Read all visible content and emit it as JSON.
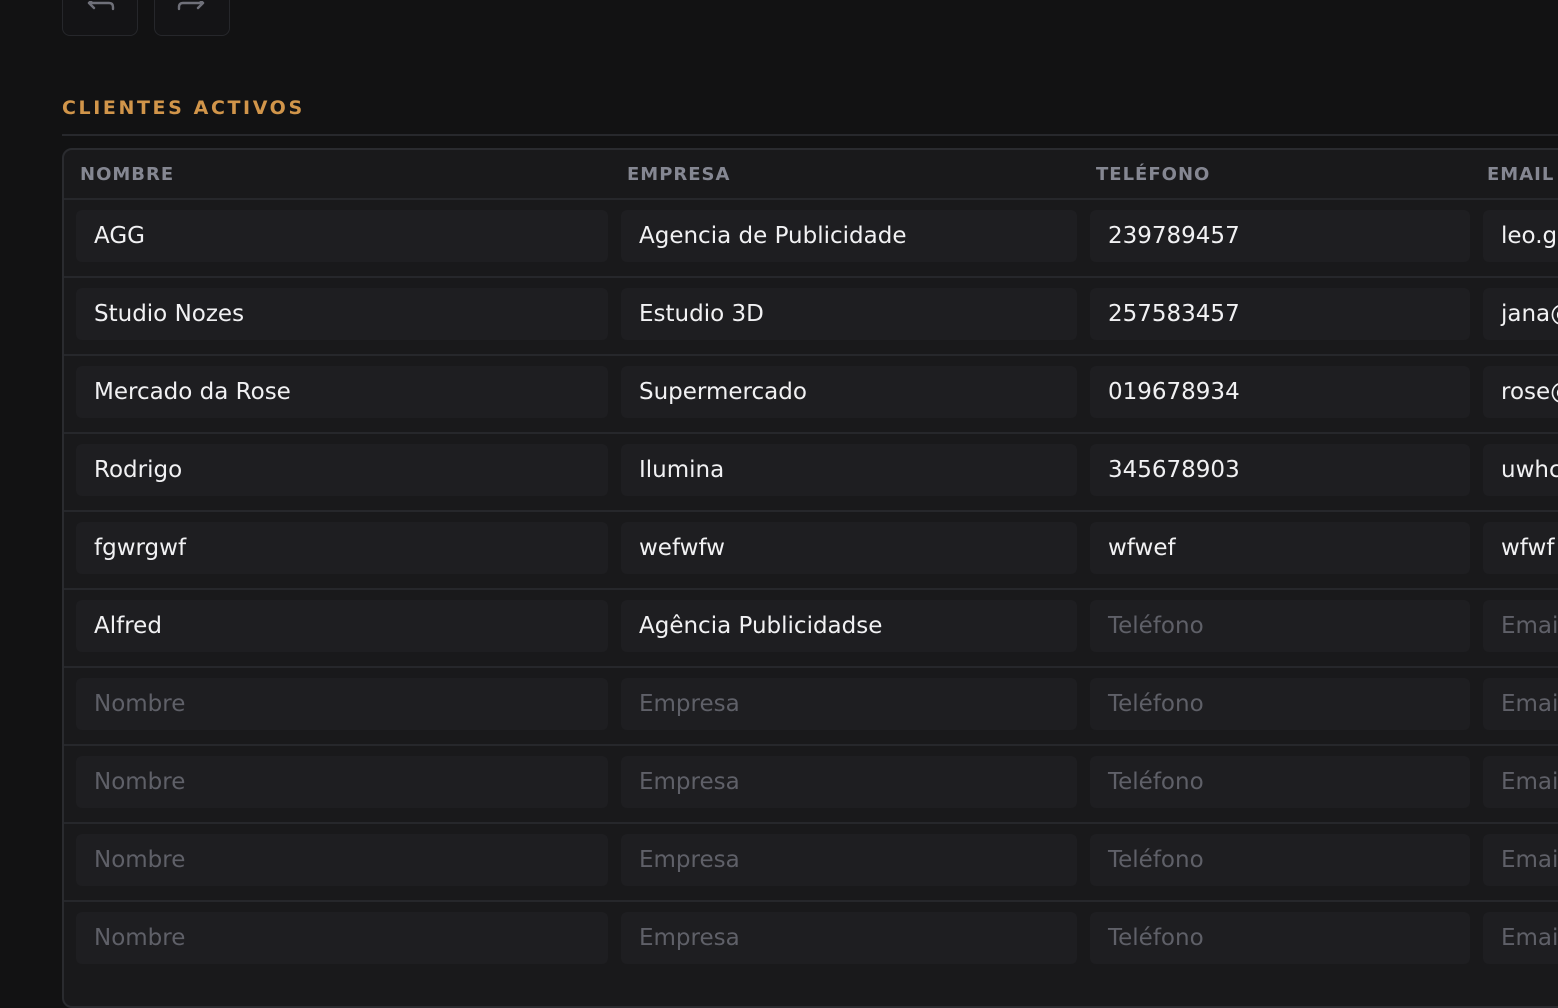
{
  "section_title": "CLIENTES ACTIVOS",
  "toolbar": {
    "undo_icon": "undo-icon",
    "redo_icon": "redo-icon"
  },
  "columns": [
    "NOMBRE",
    "EMPRESA",
    "TELÉFONO",
    "EMAIL"
  ],
  "placeholders": {
    "nombre": "Nombre",
    "empresa": "Empresa",
    "telefono": "Teléfono",
    "email": "Email"
  },
  "rows": [
    {
      "nombre": "AGG",
      "empresa": "Agencia de Publicidade",
      "telefono": "239789457",
      "email": "leo.g"
    },
    {
      "nombre": "Studio Nozes",
      "empresa": "Estudio 3D",
      "telefono": "257583457",
      "email": "jana@"
    },
    {
      "nombre": "Mercado da Rose",
      "empresa": "Supermercado",
      "telefono": "019678934",
      "email": "rose@"
    },
    {
      "nombre": "Rodrigo",
      "empresa": "Ilumina",
      "telefono": "345678903",
      "email": "uwhc"
    },
    {
      "nombre": "fgwrgwf",
      "empresa": "wefwfw",
      "telefono": "wfwef",
      "email": "wfwf"
    },
    {
      "nombre": "Alfred",
      "empresa": "Agência Publicidadse",
      "telefono": "",
      "email": ""
    },
    {
      "nombre": "",
      "empresa": "",
      "telefono": "",
      "email": ""
    },
    {
      "nombre": "",
      "empresa": "",
      "telefono": "",
      "email": ""
    },
    {
      "nombre": "",
      "empresa": "",
      "telefono": "",
      "email": ""
    },
    {
      "nombre": "",
      "empresa": "",
      "telefono": "",
      "email": ""
    }
  ],
  "colors": {
    "accent": "#d1954a",
    "background": "#121213",
    "placeholder": "#5f6068",
    "text": "#f1f1f3"
  }
}
